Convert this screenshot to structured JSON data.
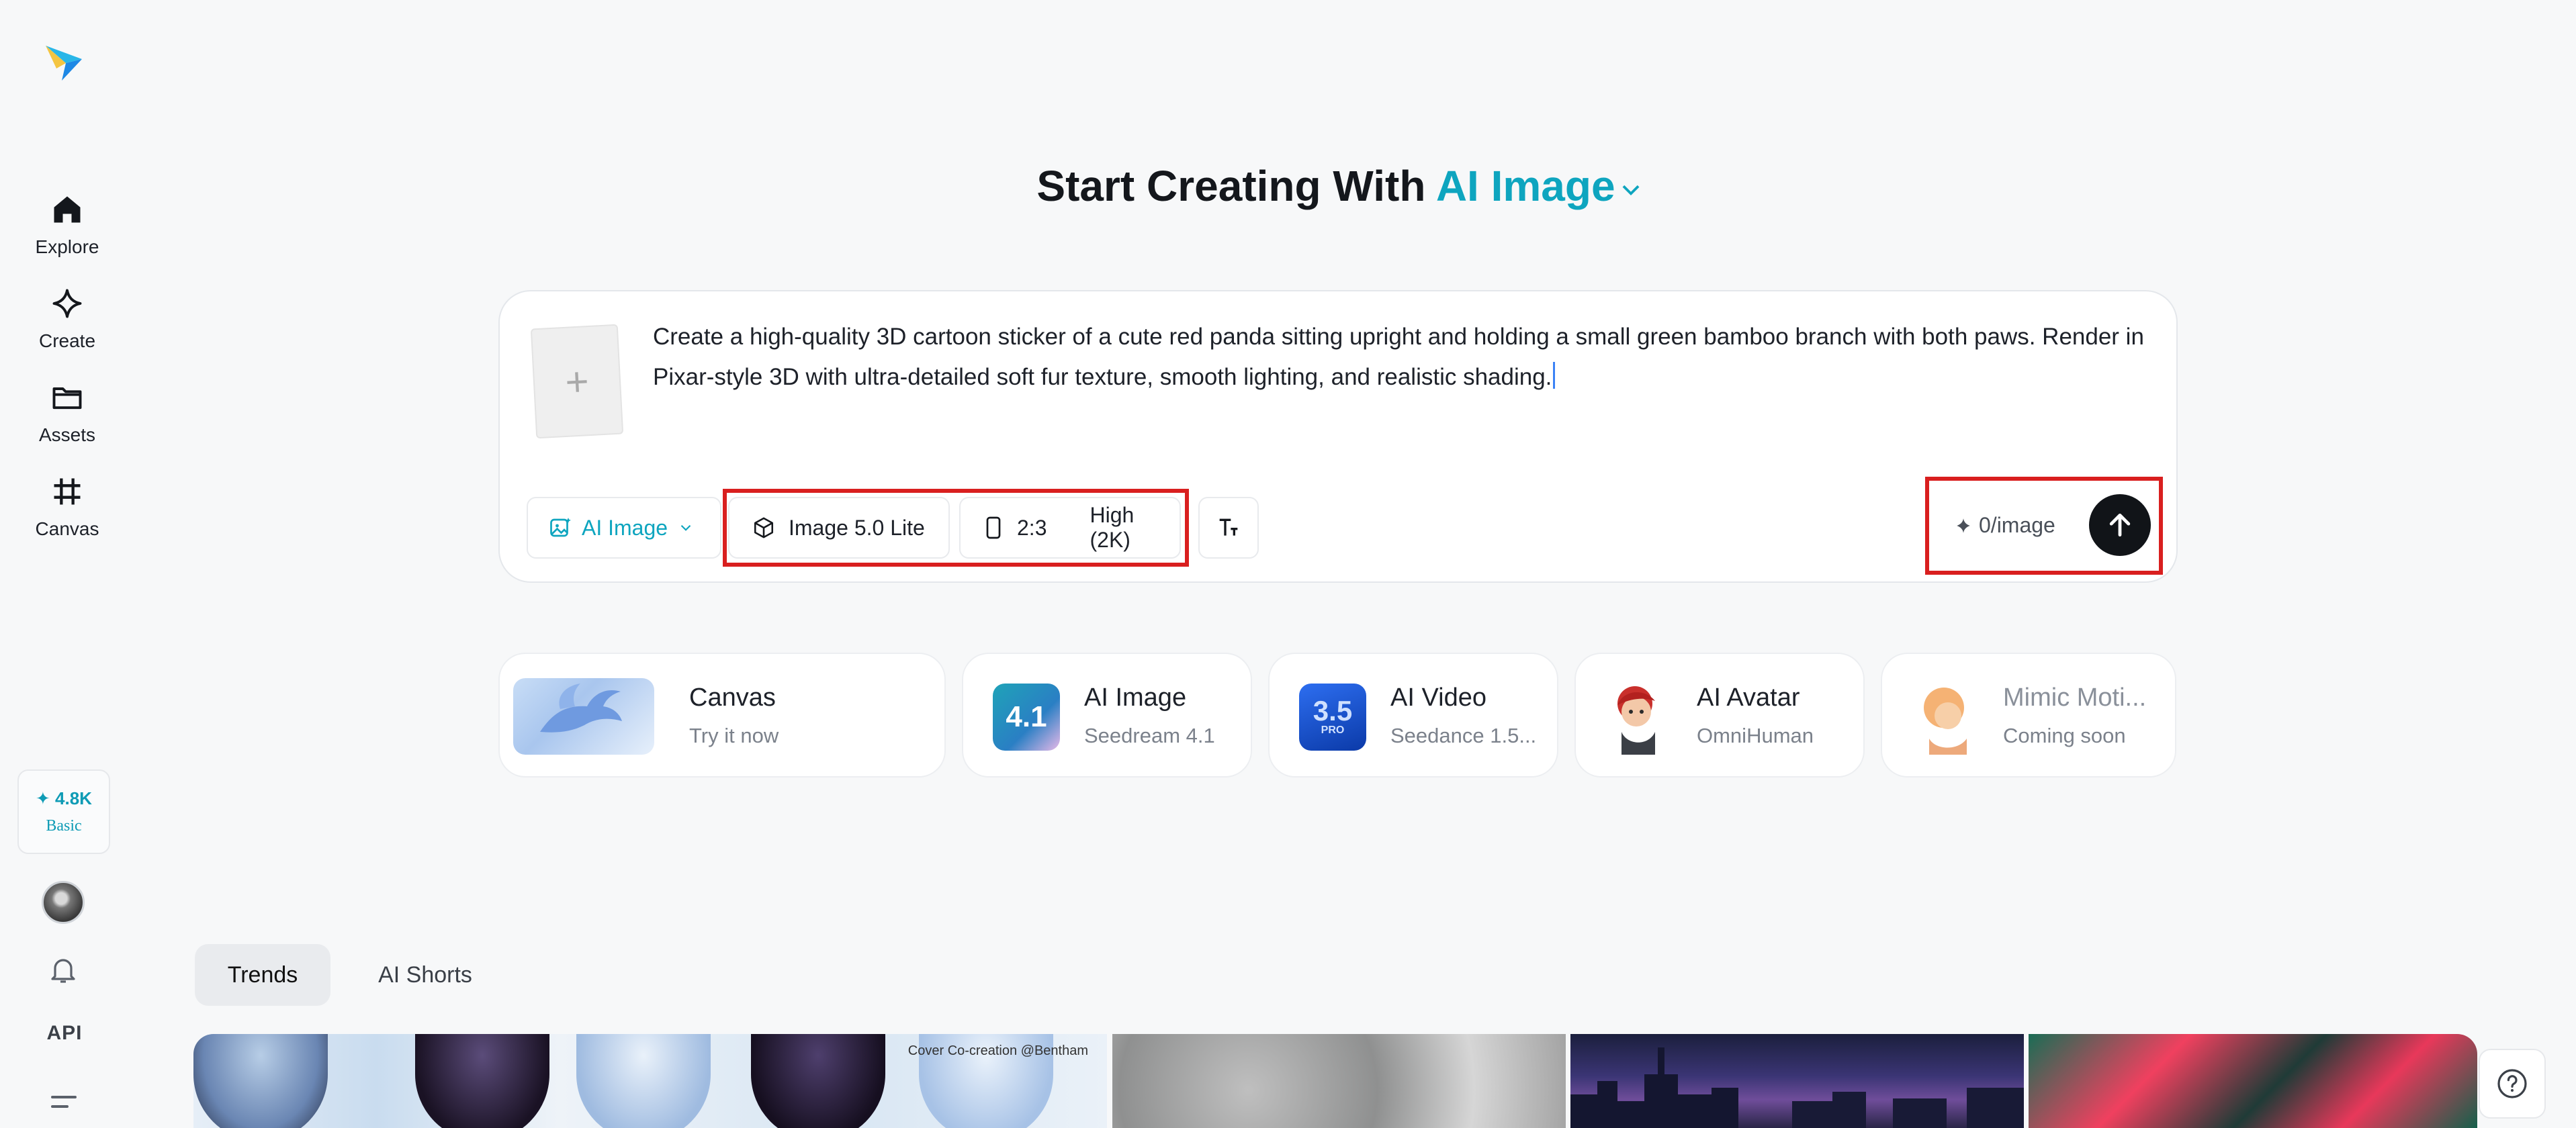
{
  "sidebar": {
    "items": [
      {
        "label": "Explore"
      },
      {
        "label": "Create"
      },
      {
        "label": "Assets"
      },
      {
        "label": "Canvas"
      }
    ],
    "credits": {
      "amount": "✦ 4.8K",
      "plan": "Basic"
    },
    "api_label": "API"
  },
  "heading": {
    "prefix": "Start Creating With",
    "mode": "AI Image"
  },
  "prompt": {
    "text": "Create a high-quality 3D cartoon sticker of a cute red panda sitting upright and holding a small green bamboo branch with both paws. Render in Pixar-style 3D with ultra-detailed soft fur texture, smooth lighting, and realistic shading.",
    "upload_symbol": "+"
  },
  "controls": {
    "type_label": "AI Image",
    "model_label": "Image 5.0 Lite",
    "ratio_label": "2:3",
    "quality_label": "High (2K)",
    "cost_label": "0/image"
  },
  "tools": [
    {
      "title": "Canvas",
      "subtitle": "Try it now"
    },
    {
      "title": "AI Image",
      "subtitle": "Seedream 4.1",
      "badge": "4.1"
    },
    {
      "title": "AI Video",
      "subtitle": "Seedance 1.5...",
      "badge": "3.5",
      "badge_sub": "PRO"
    },
    {
      "title": "AI Avatar",
      "subtitle": "OmniHuman"
    },
    {
      "title": "Mimic Moti...",
      "subtitle": "Coming soon"
    }
  ],
  "tabs": [
    {
      "label": "Trends"
    },
    {
      "label": "AI Shorts"
    }
  ],
  "gallery": {
    "credit": "Cover Co-creation @Bentham"
  },
  "colors": {
    "accent": "#0ea5bf",
    "highlight": "#d91f1f",
    "send": "#111418"
  }
}
